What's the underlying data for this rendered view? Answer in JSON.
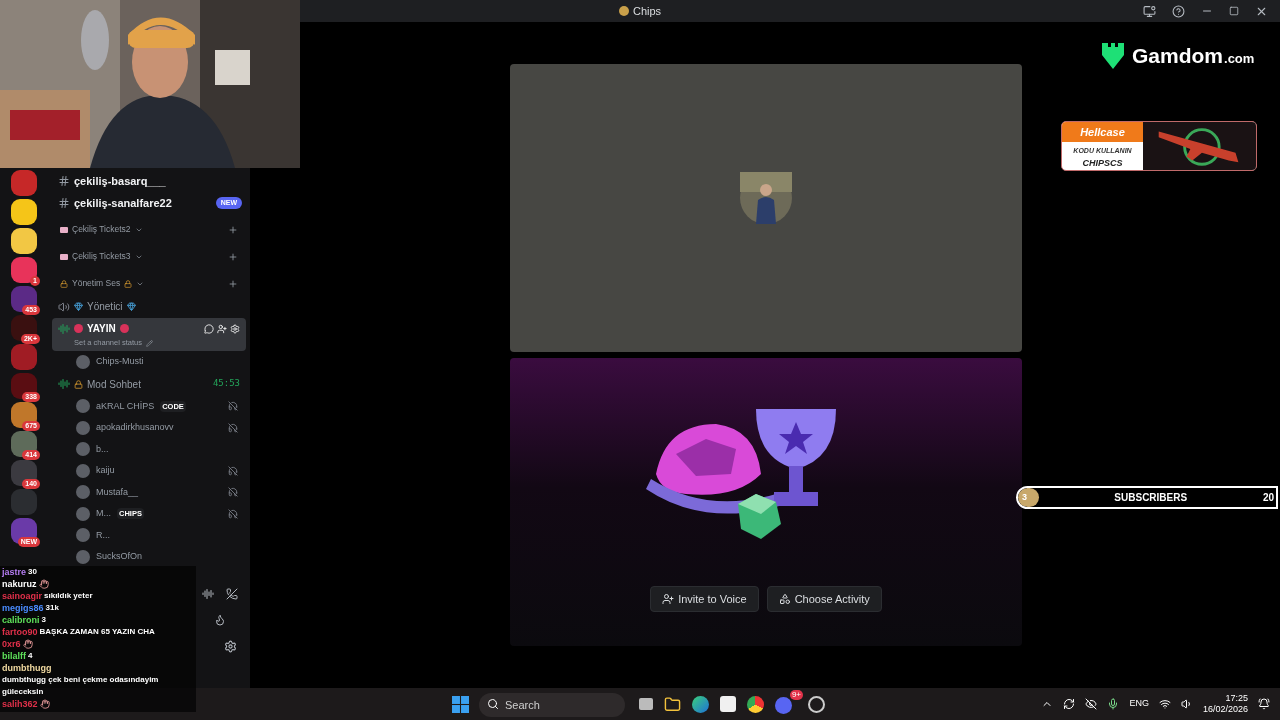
{
  "window": {
    "title": "Chips"
  },
  "servers": [
    {
      "color": "#c62828"
    },
    {
      "color": "#f5c518"
    },
    {
      "color": "#f2c744"
    },
    {
      "color": "#e8335a",
      "badge": "1"
    },
    {
      "color": "#5b2a86",
      "badge": "453"
    },
    {
      "color": "#3a1010",
      "badge": "2K+"
    },
    {
      "color": "#a01c24"
    },
    {
      "color": "#5a0d12",
      "badge": "338"
    },
    {
      "color": "#c0772a",
      "badge": "675"
    },
    {
      "color": "#5e6b5a",
      "badge": "414"
    },
    {
      "color": "#3b3a40",
      "badge": "140"
    },
    {
      "color": "#2b2d31"
    },
    {
      "color": "#6a3aa8",
      "badge": "NEW"
    }
  ],
  "channels": [
    {
      "kind": "text",
      "name": "çekiliş-basarq___"
    },
    {
      "kind": "text",
      "name": "çekiliş-sanalfare22",
      "badge": "NEW"
    },
    {
      "kind": "category",
      "name": "Çekiliş Tickets2",
      "locked": false
    },
    {
      "kind": "category",
      "name": "Çekiliş Tickets3",
      "locked": false
    },
    {
      "kind": "category",
      "name": "Yönetim Ses",
      "locked": true
    },
    {
      "kind": "voice",
      "name": "Yönetici",
      "selected": false,
      "locked": false
    },
    {
      "kind": "voice",
      "name": "YAYIN",
      "selected": true,
      "locked": false,
      "status": "Set a channel status",
      "members": [
        {
          "name": "Chips-Musti",
          "muted": false
        }
      ]
    },
    {
      "kind": "voice",
      "name": "Mod Sohbet",
      "selected": false,
      "locked": true,
      "timer": "45:53",
      "members": [
        {
          "name": "aKRAL CHİPS",
          "tag": "CODE",
          "muted": true
        },
        {
          "name": "apokadirkhusanovv",
          "muted": true
        },
        {
          "name": "b...",
          "muted": false
        },
        {
          "name": "kaiju",
          "muted": true
        },
        {
          "name": "Mustafa__",
          "muted": true
        },
        {
          "name": "M...",
          "tag": "CHIPS",
          "muted": true
        },
        {
          "name": "R...",
          "muted": false
        },
        {
          "name": "SucksOfOn",
          "muted": false
        }
      ]
    }
  ],
  "chat": [
    {
      "user": "jastre",
      "color": "#b37cf0",
      "kind": "text",
      "text": "30"
    },
    {
      "user": "nakuruz",
      "color": "#ffffff",
      "kind": "emote"
    },
    {
      "user": "sainoagir",
      "color": "#e0304a",
      "kind": "text",
      "text": "sıkıldık yeter"
    },
    {
      "user": "megigs86",
      "color": "#4a8cff",
      "kind": "text",
      "text": "31k"
    },
    {
      "user": "calibroni",
      "color": "#5ee05a",
      "kind": "text",
      "text": "3"
    },
    {
      "user": "fartoo90",
      "color": "#e0304a",
      "kind": "text",
      "text": "BAŞKA ZAMAN 65 YAZIN CHA"
    },
    {
      "user": "0xr6",
      "color": "#e0304a",
      "kind": "emote"
    },
    {
      "user": "bilalff",
      "color": "#5ee05a",
      "kind": "text",
      "text": "4"
    },
    {
      "user": "dumbthugg",
      "color": "#f0d9a0",
      "kind": "text",
      "text": "dumbthugg çek beni çekme odasındayim güleceksin"
    },
    {
      "user": "salih362",
      "color": "#e0304a",
      "kind": "emote"
    }
  ],
  "stage": {
    "buttons": [
      "Invite to Voice",
      "Choose Activity"
    ]
  },
  "overlays": {
    "logo": {
      "name": "Gamdom",
      "suffix": ".com"
    },
    "sponsor": {
      "brand": "Hellcase",
      "line": "KODU KULLANIN",
      "code": "CHIPSCS"
    },
    "subscribers": {
      "count": "3",
      "label": "SUBSCRIBERS",
      "goal": "20",
      "level": 0.08
    }
  },
  "taskbar": {
    "search": {
      "placeholder": "Search"
    },
    "discord_badge": "9+",
    "language": "ENG",
    "time": "17:25",
    "date": "16/02/2026"
  }
}
